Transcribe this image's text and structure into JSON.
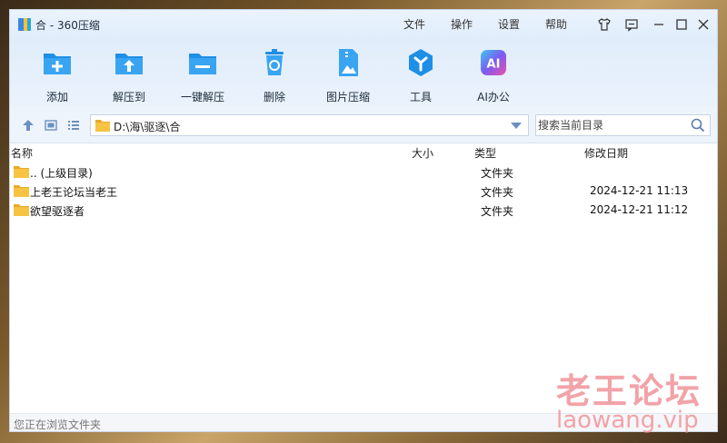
{
  "window": {
    "title": "合 - 360压缩"
  },
  "menu": [
    "文件",
    "操作",
    "设置",
    "帮助"
  ],
  "title_icons": [
    "shirt-icon",
    "message-icon",
    "minimize-icon",
    "maximize-icon",
    "close-icon"
  ],
  "toolbar": [
    {
      "label": "添加",
      "icon": "add-folder-icon"
    },
    {
      "label": "解压到",
      "icon": "extract-to-icon"
    },
    {
      "label": "一键解压",
      "icon": "one-click-extract-icon"
    },
    {
      "label": "删除",
      "icon": "trash-icon"
    },
    {
      "label": "图片压缩",
      "icon": "image-compress-icon"
    },
    {
      "label": "工具",
      "icon": "tools-icon"
    },
    {
      "label": "AI办公",
      "icon": "ai-office-icon"
    }
  ],
  "nav": {
    "path": "D:\\海\\驱逐\\合",
    "search_placeholder": "搜索当前目录"
  },
  "columns": {
    "name": "名称",
    "size": "大小",
    "type": "类型",
    "modified": "修改日期"
  },
  "rows": [
    {
      "name": ".. (上级目录)",
      "type": "文件夹",
      "date": ""
    },
    {
      "name": "上老王论坛当老王",
      "type": "文件夹",
      "date": "2024-12-21 11:13"
    },
    {
      "name": "欲望驱逐者",
      "type": "文件夹",
      "date": "2024-12-21 11:12"
    }
  ],
  "status": "您正在浏览文件夹",
  "watermark": {
    "line1": "老王论坛",
    "line2": "laowang.vip"
  },
  "colors": {
    "accent": "#1e8fe6",
    "folder": "#f6c343"
  }
}
